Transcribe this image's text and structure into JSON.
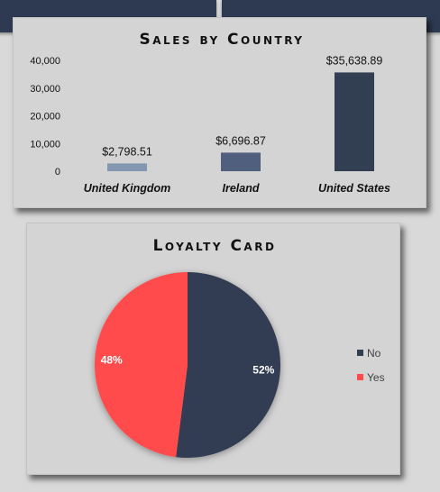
{
  "chart_data": [
    {
      "type": "bar",
      "title": "Sales by Country",
      "categories": [
        "United Kingdom",
        "Ireland",
        "United States"
      ],
      "values": [
        2798.51,
        6696.87,
        35638.89
      ],
      "value_labels": [
        "$2,798.51",
        "$6,696.87",
        "$35,638.89"
      ],
      "colors": [
        "#8497b0",
        "#4f5f7d",
        "#323e52"
      ],
      "yticks": [
        "0",
        "10,000",
        "20,000",
        "30,000",
        "40,000"
      ],
      "ylim": [
        0,
        40000
      ],
      "grid": false
    },
    {
      "type": "pie",
      "title": "Loyalty Card",
      "labels": [
        "No",
        "Yes"
      ],
      "values": [
        52,
        48
      ],
      "value_labels": [
        "52%",
        "48%"
      ],
      "colors": [
        "#323e52",
        "#ff4b4b"
      ],
      "legend_position": "right"
    }
  ]
}
